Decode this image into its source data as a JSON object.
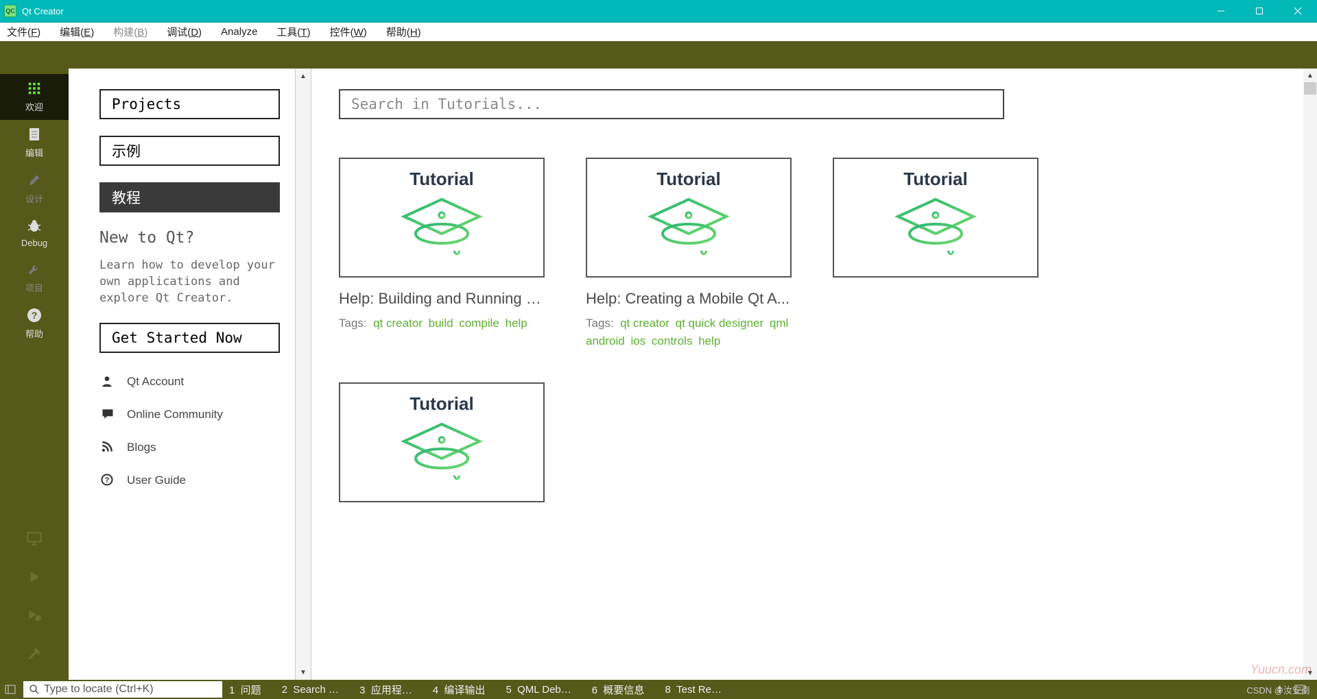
{
  "window": {
    "title": "Qt Creator",
    "app_icon_text": "QC"
  },
  "menubar": [
    {
      "label": "文件(F)",
      "key": "F",
      "disabled": false
    },
    {
      "label": "编辑(E)",
      "key": "E",
      "disabled": false
    },
    {
      "label": "构建(B)",
      "key": "B",
      "disabled": true
    },
    {
      "label": "调试(D)",
      "key": "D",
      "disabled": false
    },
    {
      "label": "Analyze",
      "key": "",
      "disabled": false
    },
    {
      "label": "工具(T)",
      "key": "T",
      "disabled": false
    },
    {
      "label": "控件(W)",
      "key": "W",
      "disabled": false
    },
    {
      "label": "帮助(H)",
      "key": "H",
      "disabled": false
    }
  ],
  "rail": {
    "items": [
      {
        "id": "welcome",
        "label": "欢迎",
        "icon": "grid-icon",
        "active": true,
        "dim": false
      },
      {
        "id": "edit",
        "label": "编辑",
        "icon": "document-icon",
        "active": false,
        "dim": false
      },
      {
        "id": "design",
        "label": "设计",
        "icon": "pencil-icon",
        "active": false,
        "dim": true
      },
      {
        "id": "debug",
        "label": "Debug",
        "icon": "bug-icon",
        "active": false,
        "dim": false
      },
      {
        "id": "projects",
        "label": "项目",
        "icon": "wrench-icon",
        "active": false,
        "dim": true
      },
      {
        "id": "help",
        "label": "帮助",
        "icon": "question-icon",
        "active": false,
        "dim": false
      }
    ],
    "footer_icons": [
      "monitor-icon",
      "play-icon",
      "play-bug-icon",
      "hammer-icon"
    ]
  },
  "welcome": {
    "nav": [
      {
        "label": "Projects",
        "selected": false
      },
      {
        "label": "示例",
        "selected": false
      },
      {
        "label": "教程",
        "selected": true
      }
    ],
    "new_heading": "New to Qt?",
    "new_body": "Learn how to develop your own applications and explore Qt Creator.",
    "get_started": "Get Started Now",
    "links": [
      {
        "label": "Qt Account",
        "icon": "person-icon"
      },
      {
        "label": "Online Community",
        "icon": "speech-icon"
      },
      {
        "label": "Blogs",
        "icon": "rss-icon"
      },
      {
        "label": "User Guide",
        "icon": "question-circle-icon"
      }
    ]
  },
  "tutorials": {
    "search_placeholder": "Search in Tutorials...",
    "thumb_label": "Tutorial",
    "tags_label": "Tags:",
    "cards": [
      {
        "title": "Help: Building and Running a...",
        "tags": [
          "qt creator",
          "build",
          "compile",
          "help"
        ]
      },
      {
        "title": "Help: Creating a Mobile Qt A...",
        "tags": [
          "qt creator",
          "qt quick designer",
          "qml",
          "android",
          "ios",
          "controls",
          "help"
        ]
      },
      {
        "title": "",
        "tags": []
      },
      {
        "title": "",
        "tags": []
      }
    ]
  },
  "statusbar": {
    "locator_placeholder": "Type to locate (Ctrl+K)",
    "panes": [
      {
        "n": "1",
        "label": "问题"
      },
      {
        "n": "2",
        "label": "Search …"
      },
      {
        "n": "3",
        "label": "应用程…"
      },
      {
        "n": "4",
        "label": "编译输出"
      },
      {
        "n": "5",
        "label": "QML Deb…"
      },
      {
        "n": "6",
        "label": "概要信息"
      },
      {
        "n": "8",
        "label": "Test Re…"
      }
    ]
  },
  "watermark": "Yuucn.com",
  "csdn": "CSDN @汝安南"
}
